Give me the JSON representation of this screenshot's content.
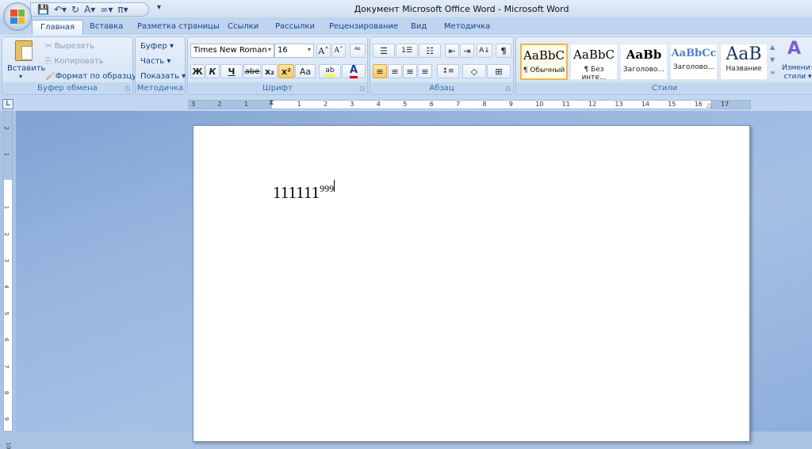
{
  "window": {
    "title": "Документ Microsoft Office Word - Microsoft Word"
  },
  "qat": {
    "items": [
      "save-icon",
      "undo-icon",
      "redo-icon",
      "font-icon",
      "infinity-icon",
      "pi-icon"
    ],
    "glyphs": [
      "💾",
      "↶▾",
      "↻",
      "A▾",
      "∞▾",
      "π▾"
    ],
    "more": "▾"
  },
  "tabs": [
    "Главная",
    "Вставка",
    "Разметка страницы",
    "Ссылки",
    "Рассылки",
    "Рецензирование",
    "Вид",
    "Методичка"
  ],
  "clipboard": {
    "paste": "Вставить",
    "cut": "Вырезать",
    "copy": "Копировать",
    "format_painter": "Формат по образцу",
    "label": "Буфер обмена"
  },
  "metodichka": {
    "items": [
      "Буфер ▾",
      "Часть ▾",
      "Показать ▾"
    ],
    "label": "Методичка"
  },
  "font": {
    "name": "Times New Roman",
    "size": "16",
    "grow": "A˄",
    "shrink": "A˅",
    "clear": "ᴬᵇ",
    "bold": "Ж",
    "italic": "К",
    "underline": "Ч",
    "strike": "abe",
    "subscript": "x₂",
    "superscript": "x²",
    "case": "Aa",
    "highlight": "ab",
    "color": "A",
    "label": "Шрифт",
    "highlight_color": "#ffff00",
    "font_color": "#e00000"
  },
  "paragraph": {
    "bullets": "☰",
    "numbering": "1☰",
    "multilevel": "☷",
    "dec_indent": "⇤",
    "inc_indent": "⇥",
    "sort": "A↓",
    "pilcrow": "¶",
    "align_left": "≡",
    "center": "≡",
    "align_right": "≡",
    "justify": "≡",
    "spacing": "↕≡",
    "shading": "◇",
    "borders": "⊞",
    "label": "Абзац"
  },
  "styles": {
    "items": [
      {
        "sample": "AaBbC",
        "name": "¶ Обычный",
        "selected": true
      },
      {
        "sample": "AaBbC",
        "name": "¶ Без инте..."
      },
      {
        "sample": "AaBb",
        "name": "Заголово..."
      },
      {
        "sample": "AaBbCc",
        "name": "Заголово..."
      },
      {
        "sample": "AaB",
        "name": "Название"
      }
    ],
    "change_styles": "Изменить стили ▾",
    "label": "Стили"
  },
  "ruler": {
    "tab_selector": "L",
    "h_labels": [
      "3",
      "2",
      "1",
      "",
      "1",
      "2",
      "3",
      "4",
      "5",
      "6",
      "7",
      "8",
      "9",
      "10",
      "11",
      "12",
      "13",
      "14",
      "15",
      "16",
      "17"
    ],
    "v_labels": [
      "2",
      "1",
      "",
      "1",
      "2",
      "3",
      "4",
      "5",
      "6",
      "7",
      "8",
      "9",
      "10"
    ]
  },
  "document": {
    "text": "111111",
    "superscript": "999"
  }
}
